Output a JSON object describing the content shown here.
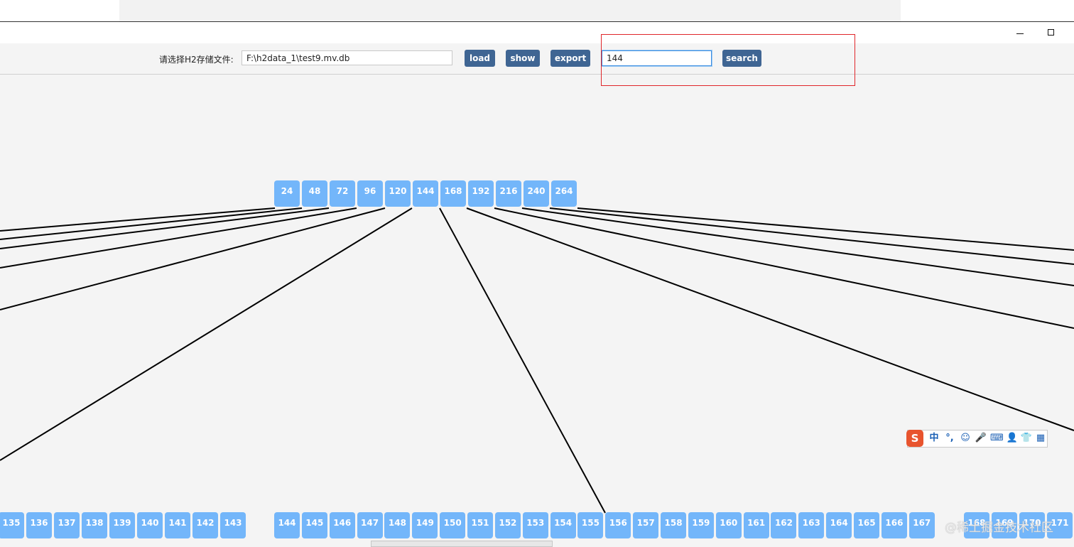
{
  "window": {
    "controls": {
      "minimize": "–",
      "maximize": "□"
    }
  },
  "toolbar": {
    "file_label": "请选择H2存储文件:",
    "file_path": "F:\\h2data_1\\test9.mv.db",
    "load_label": "load",
    "show_label": "show",
    "export_label": "export",
    "search_value": "144",
    "search_label": "search"
  },
  "tree": {
    "root_keys": [
      "24",
      "48",
      "72",
      "96",
      "120",
      "144",
      "168",
      "192",
      "216",
      "240",
      "264"
    ],
    "leaf_left": [
      "135",
      "136",
      "137",
      "138",
      "139",
      "140",
      "141",
      "142",
      "143"
    ],
    "leaf_mid": [
      "144",
      "145",
      "146",
      "147",
      "148",
      "149",
      "150",
      "151",
      "152",
      "153",
      "154",
      "155",
      "156",
      "157",
      "158",
      "159",
      "160",
      "161",
      "162",
      "163",
      "164",
      "165",
      "166",
      "167"
    ],
    "leaf_right": [
      "168",
      "169",
      "170",
      "171"
    ]
  },
  "ime": {
    "logo": "S",
    "items": [
      "中",
      "°,",
      "☺",
      "🎤",
      "⌨",
      "👤",
      "👕",
      "▦"
    ]
  },
  "watermark": "@稀土掘金技术社区",
  "colors": {
    "node_fill": "#73b6fa",
    "button": "#3f6593",
    "highlight": "#e0262a"
  }
}
